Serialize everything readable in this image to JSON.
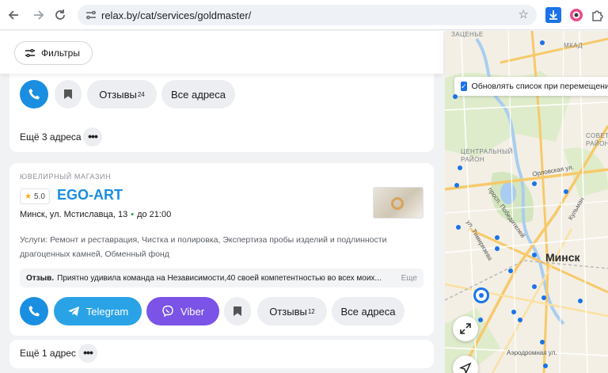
{
  "browser": {
    "url": "relax.by/cat/services/goldmaster/",
    "icons": [
      "back-icon",
      "forward-icon",
      "reload-icon",
      "site-settings-icon",
      "bookmark-star-icon",
      "download-icon",
      "extension-icon",
      "puzzle-icon"
    ]
  },
  "filters": {
    "label": "Фильтры"
  },
  "top_card": {
    "reviews_label": "Отзывы",
    "reviews_count": "24",
    "all_addresses": "Все адреса"
  },
  "more_addresses_1": "Ещё 3 адреса",
  "listing": {
    "category": "Ювелирный магазин",
    "rating": "5.0",
    "name": "EGO-ART",
    "address": "Минск, ул. Мстиславца, 13",
    "hours": "до 21:00",
    "services": "Услуги: Ремонт и реставрация, Чистка и полировка, Экспертиза пробы изделий и подлинности драгоценных камней, Обменный фонд",
    "review_label": "Отзыв.",
    "review_text": "Приятно удивила команда на Независимости,40 своей компетентностью во всех моих...",
    "review_more": "Еще",
    "telegram": "Telegram",
    "viber": "Viber",
    "reviews_label": "Отзывы",
    "reviews_count": "12",
    "all_addresses": "Все адреса"
  },
  "more_addresses_2": "Ещё 1 адрес",
  "map": {
    "checkbox_label": "Обновлять список при перемещении",
    "checkbox_checked": true,
    "labels": {
      "zatsen": "Заценье",
      "mkad": "МКАД",
      "central_district": "Центральный район",
      "sovetsky": "Совет... район",
      "orlovskaya": "Орловская ул.",
      "kulman": "Кульман",
      "pobediteley": "просп. Победителей",
      "timiryazeva": "ул. Тимирязева",
      "city": "Минск",
      "aerodromnaya": "Аэродромная ул."
    }
  },
  "colors": {
    "accent": "#1a8ee0",
    "telegram": "#2aa3e6",
    "viber": "#7b53e6",
    "map_pin": "#1a73e8"
  }
}
